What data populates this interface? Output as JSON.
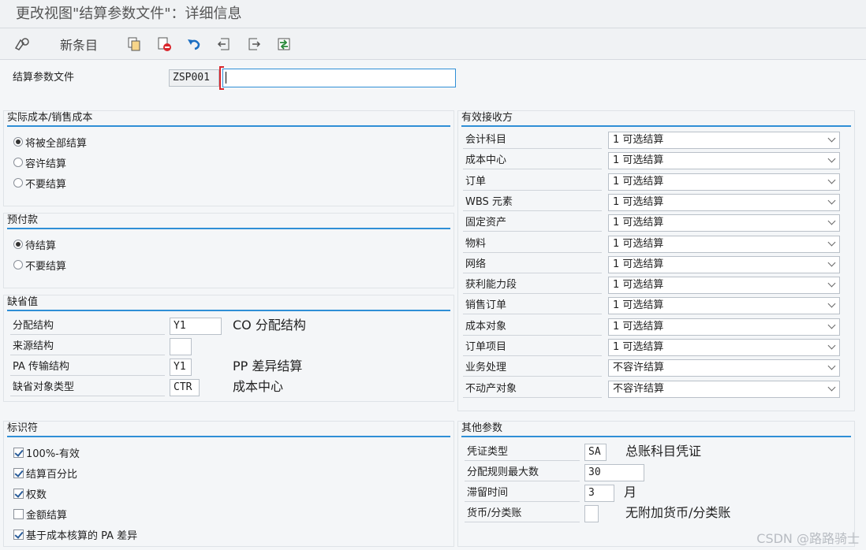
{
  "window": {
    "title": "更改视图\"结算参数文件\"：详细信息"
  },
  "toolbar": {
    "new_entries_label": "新条目"
  },
  "header": {
    "label": "结算参数文件",
    "profile_code": "ZSP001",
    "input_value": ""
  },
  "actual_cost": {
    "title": "实际成本/销售成本",
    "options": [
      "将被全部结算",
      "容许结算",
      "不要结算"
    ],
    "selected": 0
  },
  "prepayment": {
    "title": "预付款",
    "options": [
      "待结算",
      "不要结算"
    ],
    "selected": 0
  },
  "defaults": {
    "title": "缺省值",
    "rows": [
      {
        "label": "分配结构",
        "value": "Y1",
        "desc": "CO 分配结构"
      },
      {
        "label": "来源结构",
        "value": "",
        "desc": ""
      },
      {
        "label": "PA 传输结构",
        "value": "Y1",
        "desc": "PP 差异结算"
      },
      {
        "label": "缺省对象类型",
        "value": "CTR",
        "desc": "成本中心"
      }
    ]
  },
  "indicators": {
    "title": "标识符",
    "items": [
      {
        "label": "100%-有效",
        "checked": true
      },
      {
        "label": "结算百分比",
        "checked": true
      },
      {
        "label": "权数",
        "checked": true
      },
      {
        "label": "金额结算",
        "checked": false
      },
      {
        "label": "基于成本核算的 PA 差异",
        "checked": true
      }
    ]
  },
  "receivers": {
    "title": "有效接收方",
    "rows": [
      {
        "label": "会计科目",
        "value": "1 可选结算"
      },
      {
        "label": "成本中心",
        "value": "1 可选结算"
      },
      {
        "label": "订单",
        "value": "1 可选结算"
      },
      {
        "label": "WBS 元素",
        "value": "1 可选结算"
      },
      {
        "label": "固定资产",
        "value": "1 可选结算"
      },
      {
        "label": "物料",
        "value": "1 可选结算"
      },
      {
        "label": "网络",
        "value": "1 可选结算"
      },
      {
        "label": "获利能力段",
        "value": "1 可选结算"
      },
      {
        "label": "销售订单",
        "value": "1 可选结算"
      },
      {
        "label": "成本对象",
        "value": "1 可选结算"
      },
      {
        "label": "订单项目",
        "value": "1 可选结算"
      },
      {
        "label": "业务处理",
        "value": "不容许结算"
      },
      {
        "label": "不动产对象",
        "value": "不容许结算"
      }
    ]
  },
  "other": {
    "title": "其他参数",
    "rows": [
      {
        "label": "凭证类型",
        "value": "SA",
        "desc": "总账科目凭证"
      },
      {
        "label": "分配规则最大数",
        "value": "30",
        "desc": ""
      },
      {
        "label": "滞留时间",
        "value": "3",
        "desc": "月"
      },
      {
        "label": "货币/分类账",
        "value": "",
        "desc": "无附加货币/分类账"
      }
    ]
  },
  "watermark": "CSDN @路路骑士"
}
